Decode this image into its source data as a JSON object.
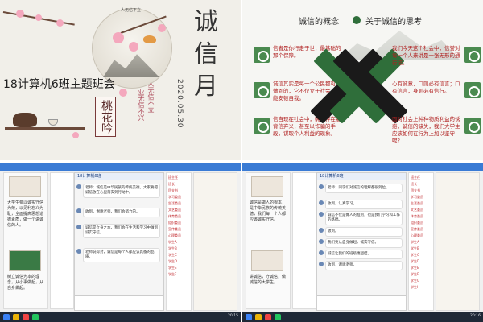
{
  "slide1": {
    "title_chars": [
      "诚",
      "信",
      "月"
    ],
    "subtitle": "18计算机6班主题班会",
    "date": "2020.05.30",
    "seal_text": "桃花吟",
    "small_top_text": "人无信不立",
    "vertical_text_1": "人无信不立",
    "vertical_text_2": "业无信不兴"
  },
  "slide2": {
    "heading_left": "诚信的概念",
    "heading_right": "关于诚信的思考",
    "left_items": [
      "信者是你行走于世，最基础的那个保障。",
      "诚信其实是每一个公民都可以做到的，它不仅立于社会，也能安顿自我。",
      "信自现在社会中，确实存在着背信弃义，甚至以诈骗的手段，谋取个人利益的现象。"
    ],
    "right_items": [
      "我们今天这个社会中，信誉对每一个人来讲是一张无形的通行证。",
      "心有诚意，口则必有信言；口有信言，身则必有信行。",
      "面对社会上种种物质利益的诱惑，诚信的缺失，我们大学生应该如何在行为上加以坚守呢？"
    ],
    "colors": {
      "accent_green": "#2f6e3a",
      "dark": "#1a1a1a",
      "text_red": "#b02020"
    }
  },
  "screenshot1": {
    "chat_title": "18计算机6班",
    "doc_text": "大学生要以诚实守信为荣，以见利忘义为耻，全面提高思想道德素质，做一个讲诚信的人。",
    "doc_text_2": "树立诚信为本的理念，从小事做起，从自身做起。",
    "messages": [
      "老师：诚信是中华民族的传统美德，大家要把诚信放在心里落实到行动中。",
      "收到，谢谢老师，我们会努力的。",
      "诚信是立身之本，我们会在生活和学习中做到诚实守信。",
      "老师说得对，诚信是每个人都应该具备的品质。"
    ],
    "members": [
      "班主任",
      "班长",
      "团支书",
      "学习委员",
      "生活委员",
      "文艺委员",
      "体育委员",
      "组织委员",
      "宣传委员",
      "心理委员",
      "学生A",
      "学生B",
      "学生C",
      "学生D",
      "学生E",
      "学生F"
    ],
    "clock": "20:15"
  },
  "screenshot2": {
    "chat_title": "18计算机6班",
    "doc_text": "诚信是做人的根本，是中华民族的传统美德，我们每一个人都应该诚实守信。",
    "doc_text_2": "讲诚信，守诚信，做诚信的大学生。",
    "messages": [
      "老师：同学们对诚信的理解都很到位。",
      "收到，认真学习。",
      "诚信不仅是做人的准则，也是我们学习和工作的基础。",
      "收到。",
      "我们要从自身做起，诚实守信。",
      "诚信让我们的班级更团结。",
      "收到，谢谢老师。"
    ],
    "members": [
      "班主任",
      "班长",
      "团支书",
      "学习委员",
      "生活委员",
      "文艺委员",
      "体育委员",
      "组织委员",
      "宣传委员",
      "心理委员",
      "学生A",
      "学生B",
      "学生C",
      "学生D",
      "学生E",
      "学生F",
      "学生G",
      "学生H"
    ],
    "clock": "20:16"
  }
}
